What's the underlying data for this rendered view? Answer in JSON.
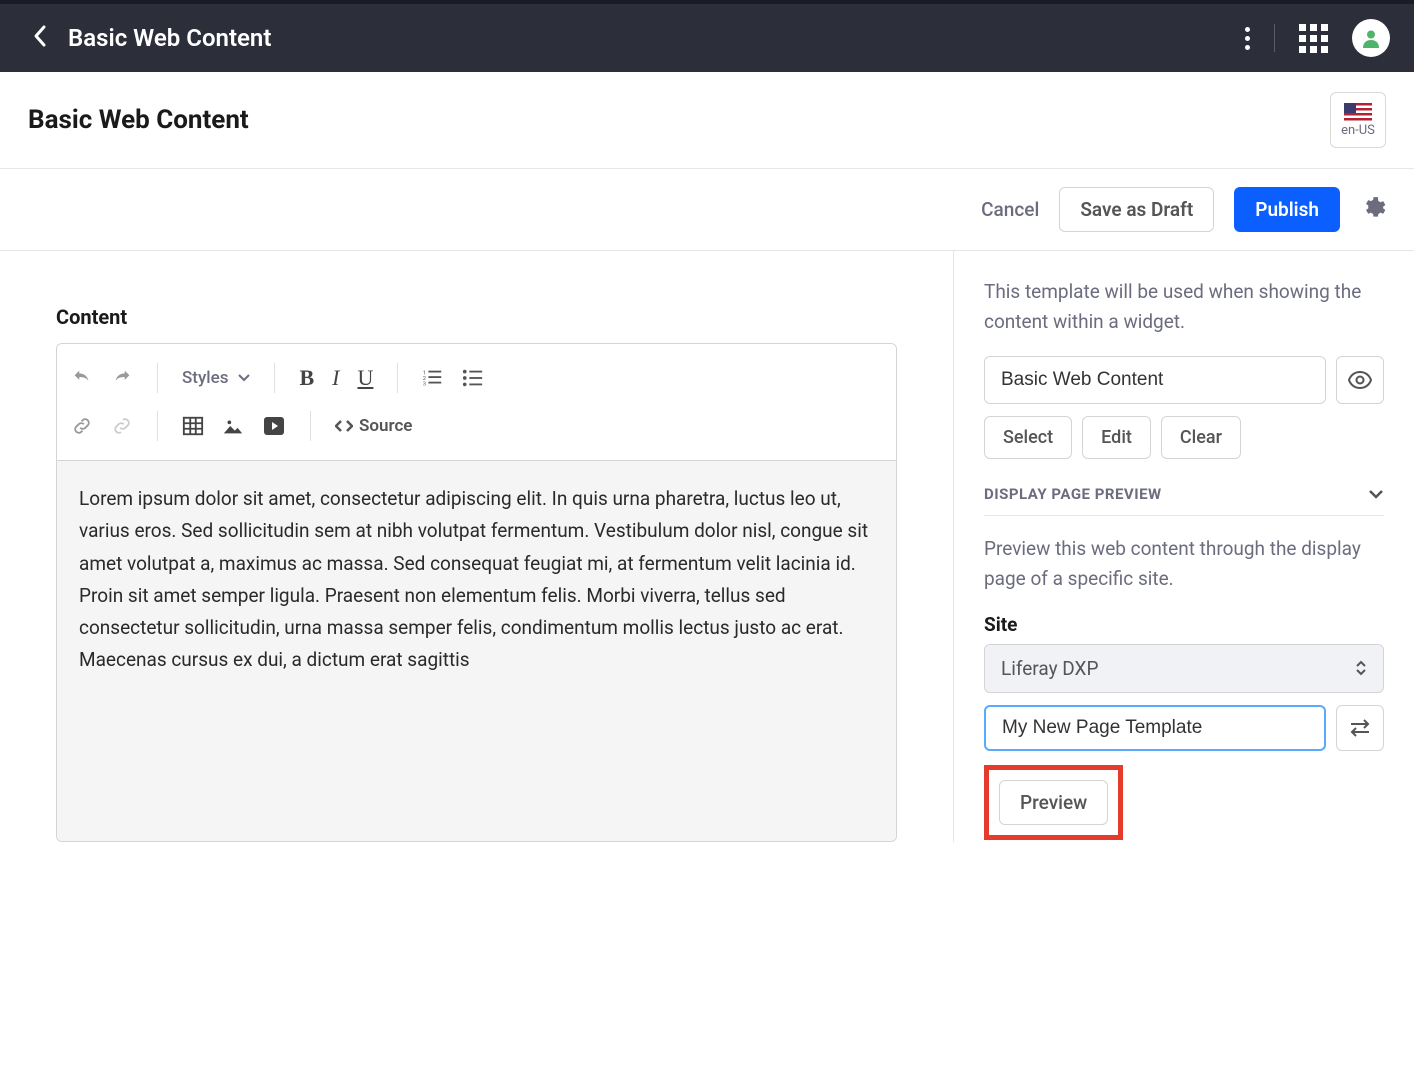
{
  "topbar": {
    "title": "Basic Web Content"
  },
  "header": {
    "title": "Basic Web Content",
    "locale": "en-US"
  },
  "actions": {
    "cancel": "Cancel",
    "save_draft": "Save as Draft",
    "publish": "Publish"
  },
  "editor": {
    "content_label": "Content",
    "styles_label": "Styles",
    "source_label": "Source",
    "body": "Lorem ipsum dolor sit amet, consectetur adipiscing elit. In quis urna pharetra, luctus leo ut, varius eros. Sed sollicitudin sem at nibh volutpat fermentum. Vestibulum dolor nisl, congue sit amet volutpat a, maximus ac massa. Sed consequat feugiat mi, at fermentum velit lacinia id. Proin sit amet semper ligula. Praesent non elementum felis. Morbi viverra, tellus sed consectetur sollicitudin, urna massa semper felis, condimentum mollis lectus justo ac erat. Maecenas cursus ex dui, a dictum erat sagittis"
  },
  "sidebar": {
    "template_desc": "This template will be used when showing the content within a widget.",
    "template_name": "Basic Web Content",
    "select": "Select",
    "edit": "Edit",
    "clear": "Clear",
    "section_title": "DISPLAY PAGE PREVIEW",
    "preview_desc": "Preview this web content through the display page of a specific site.",
    "site_label": "Site",
    "site_value": "Liferay DXP",
    "page_template_value": "My New Page Template",
    "preview_btn": "Preview"
  }
}
